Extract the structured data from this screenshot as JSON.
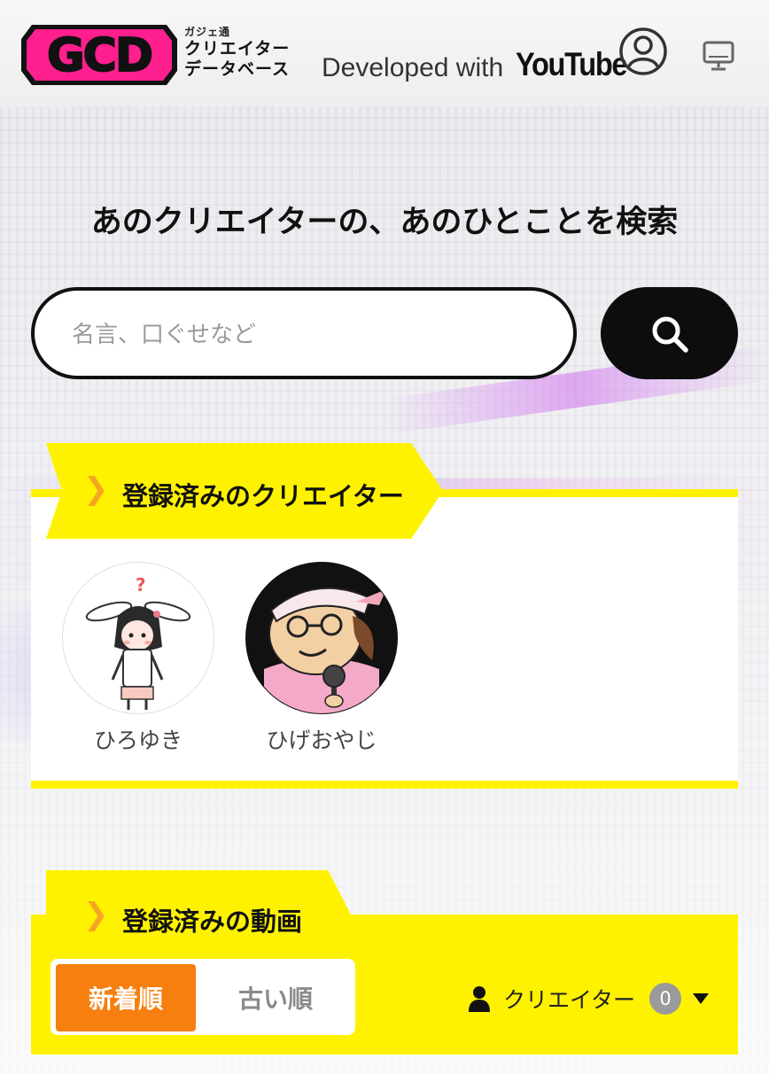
{
  "header": {
    "logo_text": "GCD",
    "logo_sub_small": "ガジェ通",
    "logo_sub_line1": "クリエイター",
    "logo_sub_line2": "データベース",
    "developed_with": "Developed with",
    "youtube": "YouTube",
    "icons": [
      "user-circle-icon",
      "monitor-icon"
    ]
  },
  "headline": "あのクリエイターの、あのひとことを検索",
  "search": {
    "placeholder": "名言、口ぐせなど",
    "value": "",
    "button_icon": "search-icon"
  },
  "creators_section": {
    "title": "登録済みのクリエイター",
    "chevron": "❯",
    "creators": [
      {
        "name": "ひろゆき"
      },
      {
        "name": "ひげおやじ"
      }
    ]
  },
  "videos_section": {
    "title": "登録済みの動画",
    "chevron": "❯",
    "sort_options": [
      "新着順",
      "古い順"
    ],
    "selected_sort": "新着順",
    "filter_label": "クリエイター",
    "filter_count": "0"
  },
  "colors": {
    "accent_yellow": "#fff200",
    "orange": "#f77f0f",
    "chevron": "#f5a623",
    "logo_pink": "#ff1f8e"
  }
}
